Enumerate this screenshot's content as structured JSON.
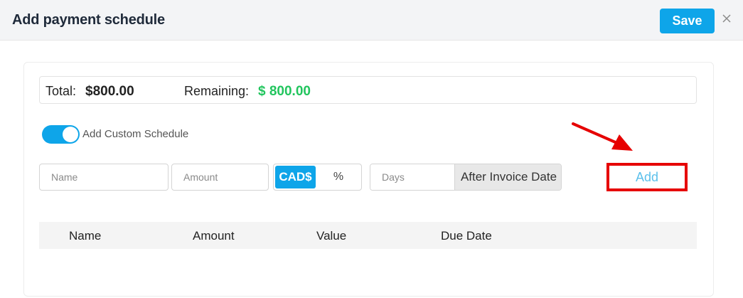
{
  "dialog": {
    "title": "Add payment schedule",
    "save_label": "Save",
    "close_icon": "close-icon"
  },
  "totals": {
    "total_label": "Total:",
    "total_value": "$800.00",
    "remaining_label": "Remaining:",
    "remaining_value": "$ 800.00",
    "remaining_color": "#22c55e"
  },
  "custom_schedule": {
    "enabled": true,
    "label": "Add Custom Schedule"
  },
  "form": {
    "name_placeholder": "Name",
    "amount_placeholder": "Amount",
    "unit_options": [
      "CAD$",
      "%"
    ],
    "unit_selected": "CAD$",
    "days_placeholder": "Days",
    "days_suffix": "After Invoice Date",
    "add_label": "Add"
  },
  "table": {
    "columns": [
      "Name",
      "Amount",
      "Value",
      "Due Date"
    ],
    "rows": []
  },
  "colors": {
    "accent": "#0ea5e9",
    "annotation": "#e60000"
  }
}
